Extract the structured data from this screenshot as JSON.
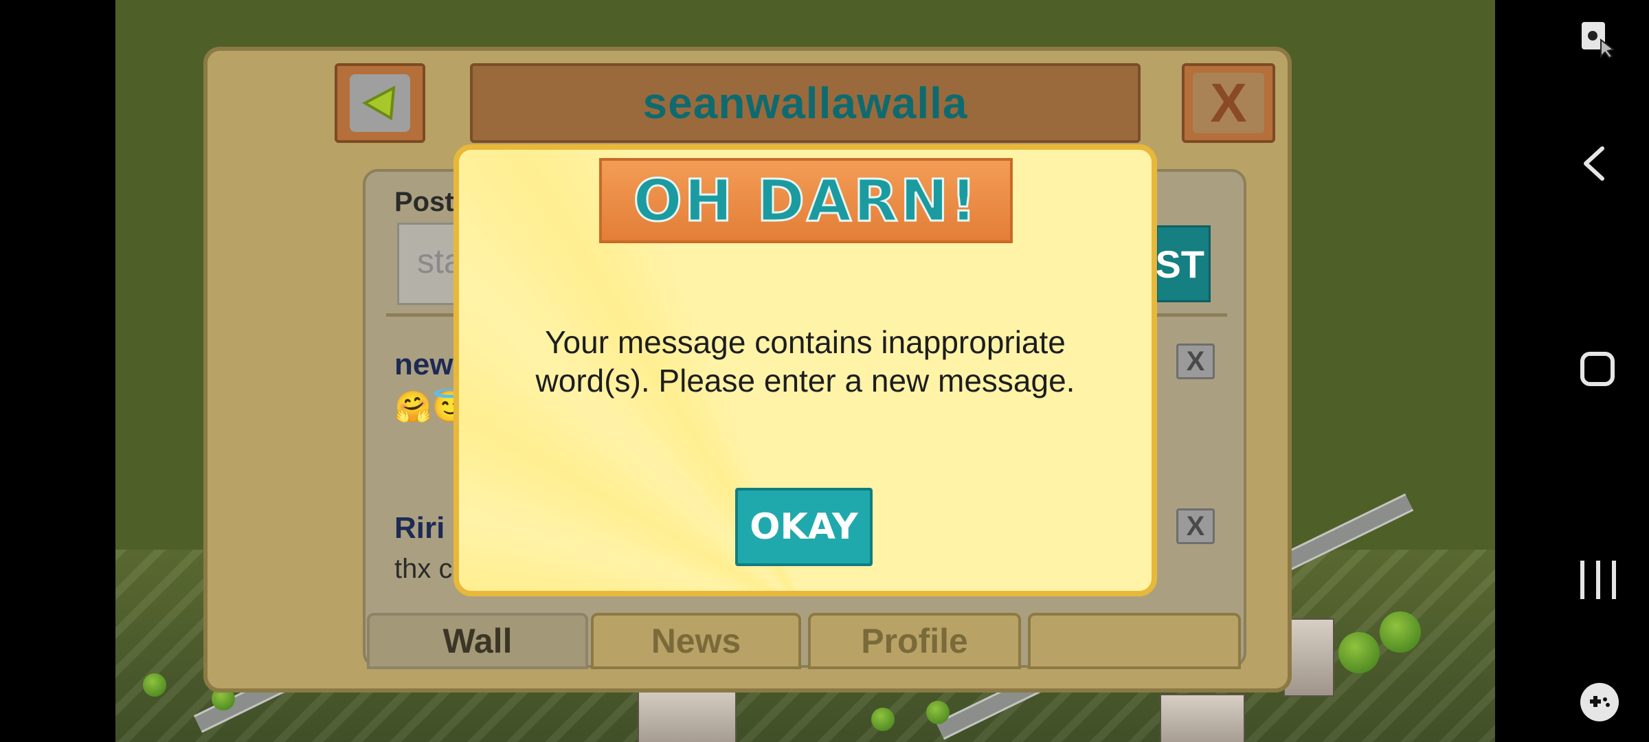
{
  "window": {
    "username": "seanwallawalla",
    "back_icon": "green-left-arrow",
    "close_label": "X"
  },
  "composer": {
    "post_label": "Post",
    "input_placeholder": "sta",
    "post_button_label": "ST"
  },
  "wall": {
    "posts": [
      {
        "author": "new",
        "text": "🤗😇"
      },
      {
        "author": "Riri",
        "text": "thx c"
      }
    ],
    "delete_label": "X"
  },
  "tabs": [
    {
      "label": "Wall"
    },
    {
      "label": "News"
    },
    {
      "label": "Profile"
    },
    {
      "label": ""
    }
  ],
  "dialog": {
    "title": "OH DARN!",
    "message_line1": "Your message contains inappropriate",
    "message_line2": "word(s).  Please enter a new message.",
    "button_label": "OKAY"
  },
  "system_nav": {
    "icons": [
      "screen-tool-icon",
      "back-icon",
      "home-icon",
      "recents-icon",
      "game-launcher-icon"
    ]
  }
}
